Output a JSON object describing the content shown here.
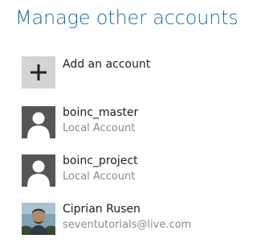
{
  "header": {
    "title": "Manage other accounts"
  },
  "add_account": {
    "label": "Add an account",
    "icon": "plus-icon"
  },
  "accounts": [
    {
      "name": "boinc_master",
      "type": "Local Account",
      "icon": "user-silhouette-icon"
    },
    {
      "name": "boinc_project",
      "type": "Local Account",
      "icon": "user-silhouette-icon"
    },
    {
      "name": "Ciprian Rusen",
      "type": "seventutorials@live.com",
      "icon": "user-photo"
    }
  ],
  "colors": {
    "title": "#1c6ea4",
    "tile_user": "#555555",
    "tile_add": "#d4d4d4"
  }
}
